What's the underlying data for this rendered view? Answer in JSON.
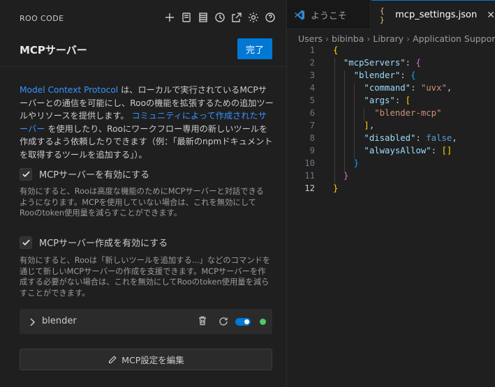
{
  "panel": {
    "app_title": "ROO CODE",
    "heading": "MCPサーバー",
    "done_label": "完了",
    "description": {
      "link1": "Model Context Protocol",
      "text1": " は、ローカルで実行されているMCPサーバーとの通信を可能にし、Rooの機能を拡張するための追加ツールやリソースを提供します。 ",
      "link2": "コミュニティによって作成されたサーバー",
      "text2": " を使用したり、Rooにワークフロー専用の新しいツールを作成するよう依頼したりできます（例：「最新のnpmドキュメントを取得するツールを追加する」）。"
    },
    "option1": {
      "label": "MCPサーバーを有効にする",
      "checked": true,
      "help": "有効にすると、Rooは高度な機能のためにMCPサーバーと対話できるようになります。MCPを使用していない場合は、これを無効にしてRooのtoken使用量を減らすことができます。"
    },
    "option2": {
      "label": "MCPサーバー作成を有効にする",
      "checked": true,
      "help": "有効にすると、Rooは「新しいツールを追加する...」などのコマンドを通じて新しいMCPサーバーの作成を支援できます。MCPサーバーを作成する必要がない場合は、これを無効にしてRooのtoken使用量を減らすことができます。"
    },
    "server": {
      "name": "blender",
      "enabled": true,
      "status_color": "#4ec96a"
    },
    "edit_label": "MCP設定を編集",
    "toolbar_icons": [
      "plus-icon",
      "history-icon",
      "server-icon",
      "clock-icon",
      "popout-icon",
      "gear-icon",
      "help-icon"
    ]
  },
  "editor": {
    "tabs": [
      {
        "label": "ようこそ",
        "icon": "vscode-icon",
        "active": false
      },
      {
        "label": "mcp_settings.json",
        "icon": "json-icon",
        "active": true
      }
    ],
    "breadcrumb": [
      "Users",
      "bibinba",
      "Library",
      "Application Support"
    ],
    "lines": [
      {
        "n": "1"
      },
      {
        "n": "2",
        "key": "\"mcpServers\""
      },
      {
        "n": "3",
        "key": "\"blender\""
      },
      {
        "n": "4",
        "key": "\"command\"",
        "value": "\"uvx\""
      },
      {
        "n": "5",
        "key": "\"args\""
      },
      {
        "n": "6",
        "value": "\"blender-mcp\""
      },
      {
        "n": "7"
      },
      {
        "n": "8",
        "key": "\"disabled\"",
        "value": "false"
      },
      {
        "n": "9",
        "key": "\"alwaysAllow\""
      },
      {
        "n": "10"
      },
      {
        "n": "11"
      },
      {
        "n": "12"
      }
    ]
  },
  "colors": {
    "accent": "#0078d4",
    "link": "#3794ff",
    "status_green": "#4ec96a"
  }
}
